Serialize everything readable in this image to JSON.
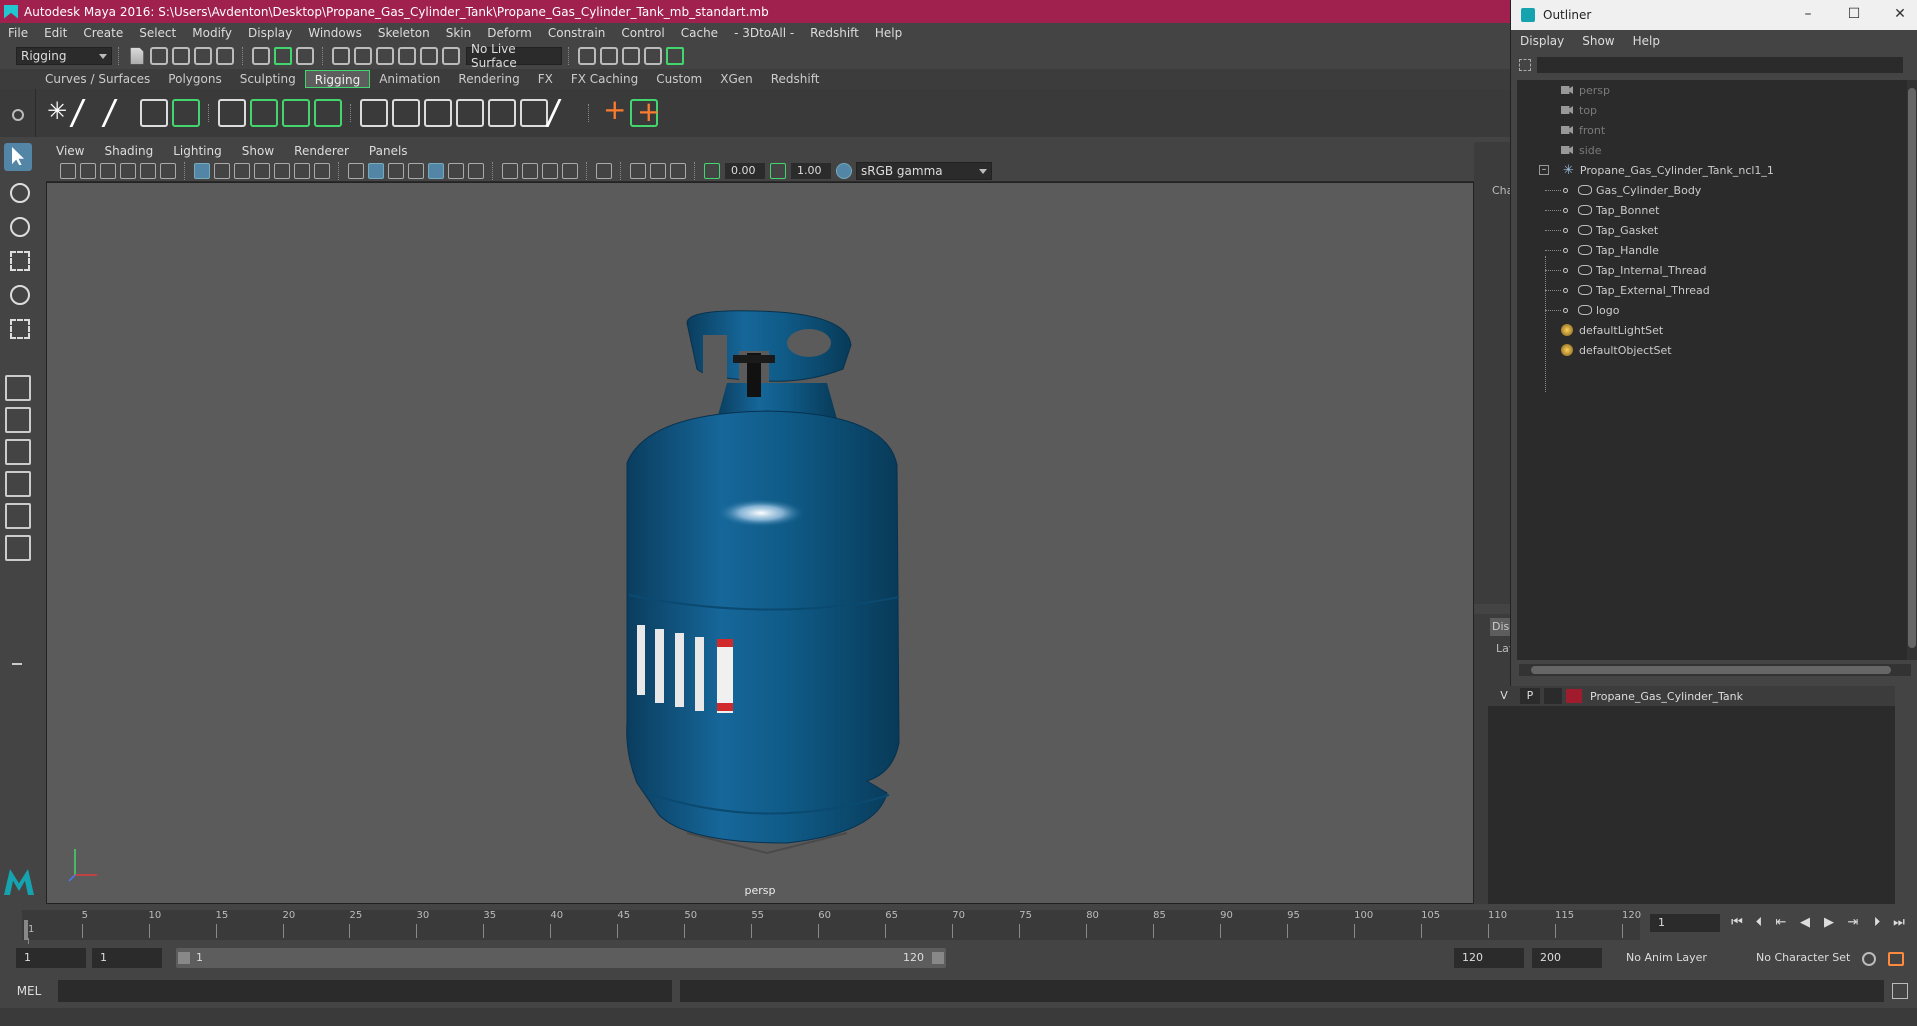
{
  "window": {
    "title": "Autodesk Maya 2016: S:\\Users\\Avdenton\\Desktop\\Propane_Gas_Cylinder_Tank\\Propane_Gas_Cylinder_Tank_mb_standart.mb"
  },
  "menubar": [
    "File",
    "Edit",
    "Create",
    "Select",
    "Modify",
    "Display",
    "Windows",
    "Skeleton",
    "Skin",
    "Deform",
    "Constrain",
    "Control",
    "Cache",
    "- 3DtoAll -",
    "Redshift",
    "Help"
  ],
  "statusline": {
    "mode": "Rigging",
    "live_surface": "No Live Surface"
  },
  "shelf_tabs": [
    {
      "label": "Curves / Surfaces",
      "active": false
    },
    {
      "label": "Polygons",
      "active": false
    },
    {
      "label": "Sculpting",
      "active": false
    },
    {
      "label": "Rigging",
      "active": true
    },
    {
      "label": "Animation",
      "active": false
    },
    {
      "label": "Rendering",
      "active": false
    },
    {
      "label": "FX",
      "active": false
    },
    {
      "label": "FX Caching",
      "active": false
    },
    {
      "label": "Custom",
      "active": false
    },
    {
      "label": "XGen",
      "active": false
    },
    {
      "label": "Redshift",
      "active": false
    }
  ],
  "viewport": {
    "menu": [
      "View",
      "Shading",
      "Lighting",
      "Show",
      "Renderer",
      "Panels"
    ],
    "exposure": "0.00",
    "gamma": "1.00",
    "color_space": "sRGB gamma",
    "camera_label": "persp",
    "background_color": "#5b5b5b",
    "model_color": "#0f5a86"
  },
  "outliner": {
    "title": "Outliner",
    "menu": [
      "Display",
      "Show",
      "Help"
    ],
    "cameras": [
      "persp",
      "top",
      "front",
      "side"
    ],
    "group": "Propane_Gas_Cylinder_Tank_ncl1_1",
    "children": [
      "Gas_Cylinder_Body",
      "Tap_Bonnet",
      "Tap_Gasket",
      "Tap_Handle",
      "Tap_Internal_Thread",
      "Tap_External_Thread",
      "logo"
    ],
    "sets": [
      "defaultLightSet",
      "defaultObjectSet"
    ]
  },
  "side_panels": {
    "channel_label": "Cha",
    "display_tab": "Dis",
    "layer_label": "Lay"
  },
  "layer": {
    "visible": "V",
    "playback": "P",
    "name": "Propane_Gas_Cylinder_Tank",
    "color": "#a01c2c"
  },
  "timeline": {
    "ticks": [
      "5",
      "10",
      "15",
      "20",
      "25",
      "30",
      "35",
      "40",
      "45",
      "50",
      "55",
      "60",
      "65",
      "70",
      "75",
      "80",
      "85",
      "90",
      "95",
      "100",
      "105",
      "110",
      "115",
      "120"
    ],
    "start_mark": "1",
    "current_frame": "1"
  },
  "range": {
    "start": "1",
    "playback_start": "1",
    "slider_start": "1",
    "slider_end": "120",
    "playback_end": "120",
    "end": "200",
    "anim_layer": "No Anim Layer",
    "character_set": "No Character Set"
  },
  "command_line": {
    "label": "MEL"
  }
}
